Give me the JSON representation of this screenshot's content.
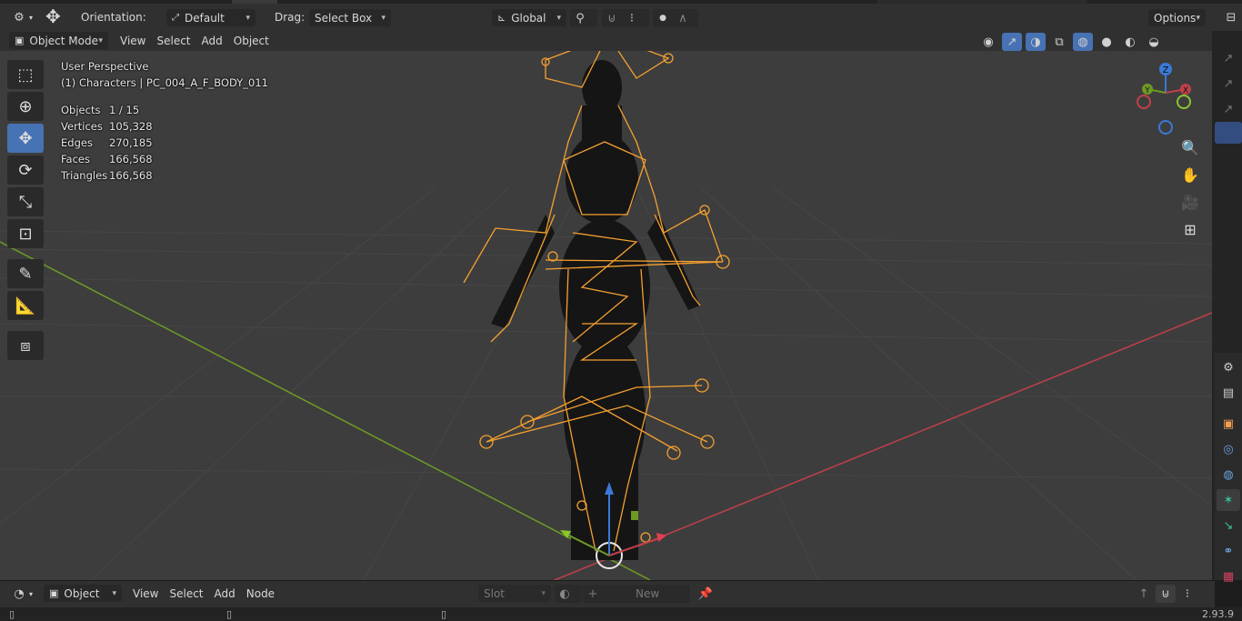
{
  "topbar": {
    "orientation_label": "Orientation:",
    "orientation_value": "Default",
    "drag_label": "Drag:",
    "drag_value": "Select Box",
    "transform_space": "Global",
    "options_label": "Options"
  },
  "header": {
    "mode": "Object Mode",
    "menus": [
      "View",
      "Select",
      "Add",
      "Object"
    ]
  },
  "overlay": {
    "view_name": "User Perspective",
    "collection_object": "(1) Characters | PC_004_A_F_BODY_011",
    "stats": [
      {
        "key": "Objects",
        "value": "1 / 15"
      },
      {
        "key": "Vertices",
        "value": "105,328"
      },
      {
        "key": "Edges",
        "value": "270,185"
      },
      {
        "key": "Faces",
        "value": "166,568"
      },
      {
        "key": "Triangles",
        "value": "166,568"
      }
    ]
  },
  "gizmo": {
    "z": "Z",
    "y": "Y",
    "x": "X"
  },
  "bottom": {
    "type_value": "Object",
    "menus": [
      "View",
      "Select",
      "Add",
      "Node"
    ],
    "slot_label": "Slot",
    "new_label": "New"
  },
  "status": {
    "version": "2.93.9"
  },
  "colors": {
    "accent_blue": "#4772b3",
    "bone_orange": "#f5a030",
    "x_axis": "#c0404a",
    "y_axis": "#6f9a25"
  }
}
